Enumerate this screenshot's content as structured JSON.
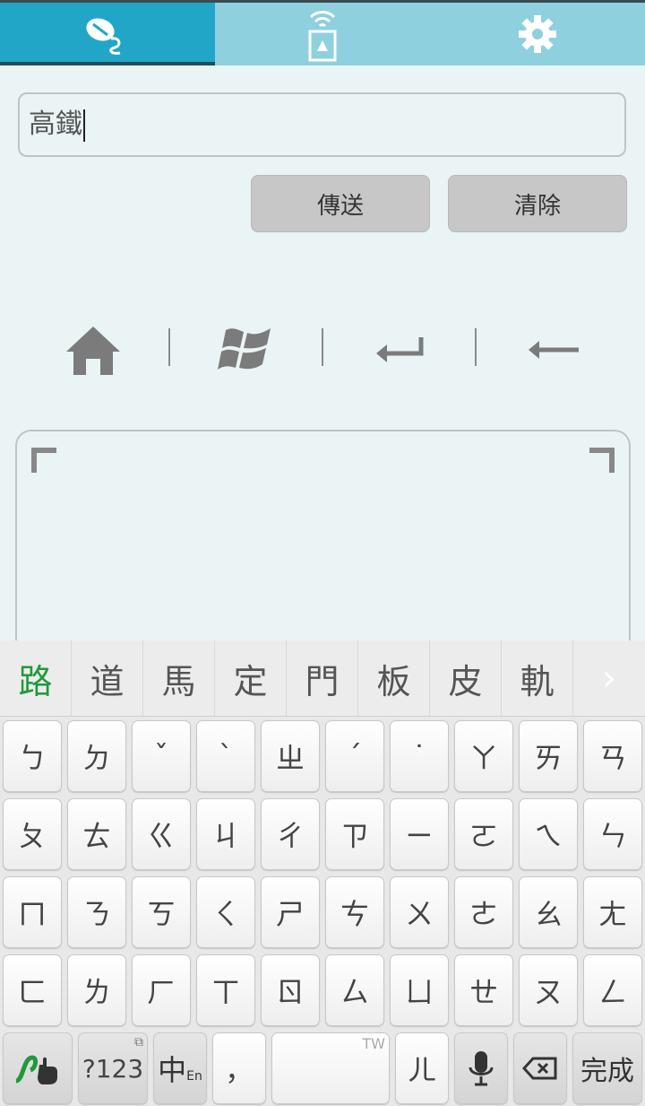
{
  "tabs": [
    {
      "icon": "mouse-icon",
      "active": true
    },
    {
      "icon": "wireless-screen-icon",
      "active": false
    },
    {
      "icon": "gear-icon",
      "active": false
    }
  ],
  "input": {
    "value": "高鐵"
  },
  "buttons": {
    "send": "傳送",
    "clear": "清除"
  },
  "shortcuts": [
    "home-icon",
    "windows-icon",
    "enter-icon",
    "backspace-arrow-icon"
  ],
  "candidates": [
    "路",
    "道",
    "馬",
    "定",
    "門",
    "板",
    "皮",
    "軌"
  ],
  "candidate_more": "›",
  "keyboard": {
    "row1": [
      "ㄅ",
      "ㄉ",
      "ˇ",
      "ˋ",
      "ㄓ",
      "ˊ",
      "˙",
      "ㄚ",
      "ㄞ",
      "ㄢ"
    ],
    "row2": [
      "ㄆ",
      "ㄊ",
      "ㄍ",
      "ㄐ",
      "ㄔ",
      "ㄗ",
      "ㄧ",
      "ㄛ",
      "ㄟ",
      "ㄣ"
    ],
    "row3": [
      "ㄇ",
      "ㄋ",
      "ㄎ",
      "ㄑ",
      "ㄕ",
      "ㄘ",
      "ㄨ",
      "ㄜ",
      "ㄠ",
      "ㄤ"
    ],
    "row4": [
      "ㄈ",
      "ㄌ",
      "ㄏ",
      "ㄒ",
      "ㄖ",
      "ㄙ",
      "ㄩ",
      "ㄝ",
      "ㄡ",
      "ㄥ"
    ],
    "num_label": "?123",
    "lang_label": "中",
    "lang_sub": "En",
    "comma": "，",
    "space_hint": "TW",
    "er": "ㄦ",
    "done": "完成"
  }
}
